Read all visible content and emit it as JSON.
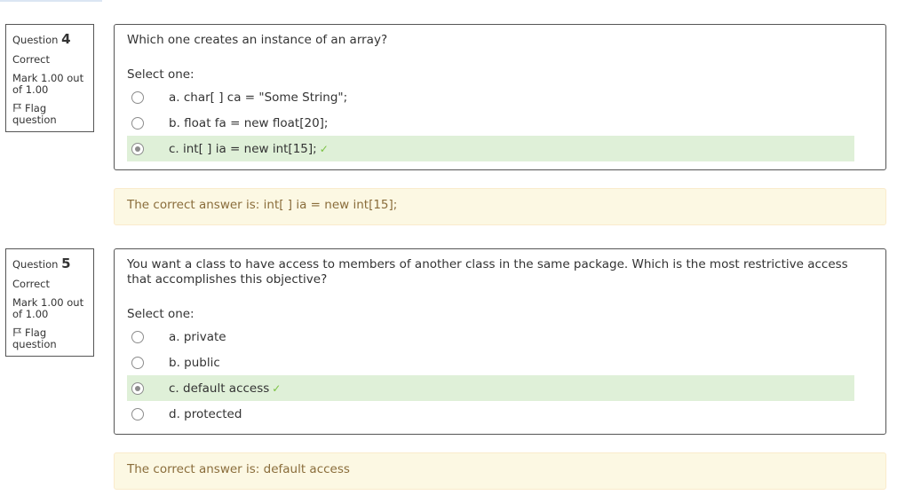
{
  "questions": [
    {
      "label": "Question",
      "number": "4",
      "state": "Correct",
      "grade": "Mark 1.00 out of 1.00",
      "flag_label": "Flag question",
      "text": "Which one creates an instance of an array?",
      "prompt": "Select one:",
      "options": [
        {
          "text": "a. char[ ] ca = \"Some String\";",
          "selected": false,
          "correct": false
        },
        {
          "text": "b. float fa = new float[20];",
          "selected": false,
          "correct": false
        },
        {
          "text": "c. int[ ] ia = new int[15];",
          "selected": true,
          "correct": true,
          "mark": "✓"
        }
      ],
      "feedback": "The correct answer is: int[ ] ia = new int[15];"
    },
    {
      "label": "Question",
      "number": "5",
      "state": "Correct",
      "grade": "Mark 1.00 out of 1.00",
      "flag_label": "Flag question",
      "text": "You want a class to have access to members of another class in the same package. Which is the most restrictive access that accomplishes this objective?",
      "prompt": "Select one:",
      "options": [
        {
          "text": "a. private",
          "selected": false,
          "correct": false
        },
        {
          "text": "b. public",
          "selected": false,
          "correct": false
        },
        {
          "text": "c. default access",
          "selected": true,
          "correct": true,
          "mark": "✓"
        },
        {
          "text": "d. protected",
          "selected": false,
          "correct": false
        }
      ],
      "feedback": "The correct answer is: default access"
    }
  ],
  "colors": {
    "correct_bg": "#dff0d8",
    "check": "#7ac142",
    "feedback_bg": "#fcf8e3",
    "feedback_text": "#8a6d3b",
    "border": "#555555"
  }
}
